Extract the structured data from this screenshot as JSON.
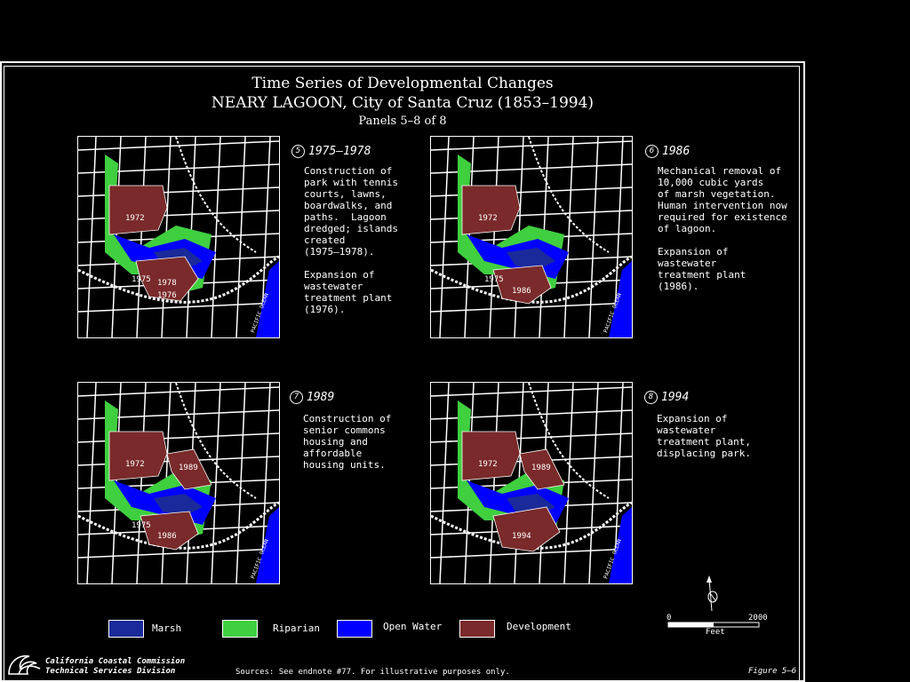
{
  "title": {
    "line1": "Time Series of Developmental Changes",
    "line2": "NEARY LAGOON, City of Santa Cruz (1853–1994)",
    "line3": "Panels 5–8 of 8"
  },
  "panels": [
    {
      "num": "5",
      "year": "1975–1978",
      "text": "Construction of\npark with tennis\ncourts, lawns,\nboardwalks, and\npaths.  Lagoon\ndredged; islands\ncreated\n(1975–1978).\n\nExpansion of\nwastewater\ntreatment plant\n(1976).",
      "labels": [
        "1972",
        "1975",
        "1976",
        "1978"
      ]
    },
    {
      "num": "6",
      "year": "1986",
      "text": "Mechanical removal of\n10,000 cubic yards\nof marsh vegetation.\nHuman intervention now\nrequired for existence\nof lagoon.\n\nExpansion of\nwastewater\ntreatment plant\n(1986).",
      "labels": [
        "1972",
        "1975",
        "1986"
      ]
    },
    {
      "num": "7",
      "year": "1989",
      "text": "Construction of\nsenior commons\nhousing and\naffordable\nhousing units.",
      "labels": [
        "1972",
        "1989",
        "1975",
        "1986"
      ]
    },
    {
      "num": "8",
      "year": "1994",
      "text": "Expansion of\nwastewater\ntreatment plant,\ndisplacing park.",
      "labels": [
        "1972",
        "1989",
        "1994"
      ]
    }
  ],
  "ocean_label": "PACIFIC OCEAN",
  "legend": [
    {
      "label": "Marsh",
      "color": "#1a2a9a"
    },
    {
      "label": "Riparian",
      "color": "#3fcf3f"
    },
    {
      "label": "Open Water",
      "color": "#0000ff"
    },
    {
      "label": "Development",
      "color": "#7a2a2a"
    }
  ],
  "scale": {
    "start": "0",
    "end": "2000",
    "unit": "Feet"
  },
  "footer": {
    "org1": "California Coastal Commission",
    "org2": "Technical Services Division",
    "sources": "Sources:  See endnote #77.  For illustrative purposes only.",
    "figure": "Figure 5–6"
  }
}
